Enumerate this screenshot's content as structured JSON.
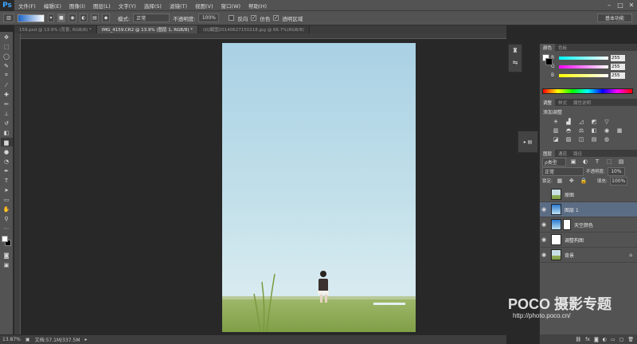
{
  "app": {
    "logo": "Ps"
  },
  "menu": [
    "文件(F)",
    "编辑(E)",
    "图像(I)",
    "图层(L)",
    "文字(Y)",
    "选择(S)",
    "滤镜(T)",
    "视图(V)",
    "窗口(W)",
    "帮助(H)"
  ],
  "window_controls": {
    "min": "–",
    "max": "□",
    "close": "✕"
  },
  "options": {
    "mode_label": "模式:",
    "mode_value": "正常",
    "opacity_label": "不透明度:",
    "opacity_value": "100%",
    "reverse_label": "反向",
    "dither_label": "仿色",
    "transparency_label": "透明区域",
    "workspace": "基本功能"
  },
  "tabs": [
    {
      "label": "159.psd @ 13.9% (背景, RGB/8) *",
      "active": false
    },
    {
      "label": "IMG_4159.CR2 @ 13.9% (图层 1, RGB/8) *",
      "active": true
    },
    {
      "label": "QQ截图20140627150218.jpg @ 66.7%(RGB/8)",
      "active": false
    }
  ],
  "status": {
    "zoom": "13.87%",
    "doc": "文档:57.1M/337.5M"
  },
  "panels": {
    "color_tabs": [
      "颜色",
      "色板"
    ],
    "r_label": "R",
    "g_label": "G",
    "b_label": "B",
    "r": "255",
    "g": "255",
    "b": "255",
    "adjust_tabs": [
      "调整",
      "样式",
      "属性说明"
    ],
    "adjust_title": "添加调整",
    "layers_tabs": [
      "图层",
      "通道",
      "路径"
    ],
    "kind_label": "ρ类型",
    "blend_mode": "正常",
    "opacity_label": "不透明度:",
    "opacity": "10%",
    "lock_label": "锁定:",
    "fill_label": "填充:",
    "fill": "100%"
  },
  "layers": [
    {
      "name": "原图",
      "visible": false,
      "thumb": "photo",
      "selected": false,
      "mask": false
    },
    {
      "name": "图层 1",
      "visible": true,
      "thumb": "gradient",
      "selected": true,
      "mask": false
    },
    {
      "name": "天空颜色",
      "visible": true,
      "thumb": "gradient",
      "selected": false,
      "mask": true
    },
    {
      "name": "调整构图",
      "visible": true,
      "thumb": "white",
      "selected": false,
      "mask": false
    },
    {
      "name": "背景",
      "visible": true,
      "thumb": "photo",
      "selected": false,
      "mask": false,
      "locked": true
    }
  ],
  "watermark": {
    "title": "POCO 摄影专题",
    "url": "http://photo.poco.cn/"
  },
  "colors": {
    "selected_layer": "#5b6c85",
    "sky_top": "#a9d1e4",
    "sky_bottom": "#dbedf1",
    "grass": "#8fae5a"
  }
}
